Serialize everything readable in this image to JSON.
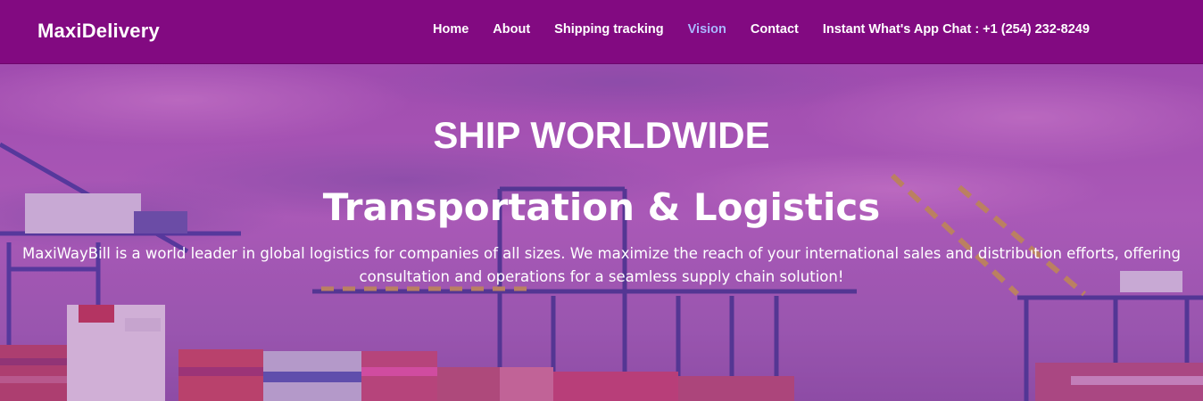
{
  "brand": {
    "name": "MaxiDelivery"
  },
  "nav": {
    "items": [
      {
        "label": "Home"
      },
      {
        "label": "About"
      },
      {
        "label": "Shipping tracking"
      },
      {
        "label": "Vision",
        "active": true
      },
      {
        "label": "Contact"
      },
      {
        "label": "Instant What's App Chat : +1 (254) 232-8249"
      }
    ]
  },
  "hero": {
    "title": "SHIP WORLDWIDE",
    "subtitle": "Transportation & Logistics",
    "description": "MaxiWayBill is a world leader in global logistics for companies of all sizes. We maximize the reach of your international sales and distribution efforts, offering consultation and operations for a seamless supply chain solution!",
    "background_image": "shipping-port-cranes-image"
  },
  "colors": {
    "navbar_bg": "#820a81",
    "nav_text": "#ffffff",
    "nav_active": "#a9b6ff",
    "hero_text": "#ffffff"
  }
}
